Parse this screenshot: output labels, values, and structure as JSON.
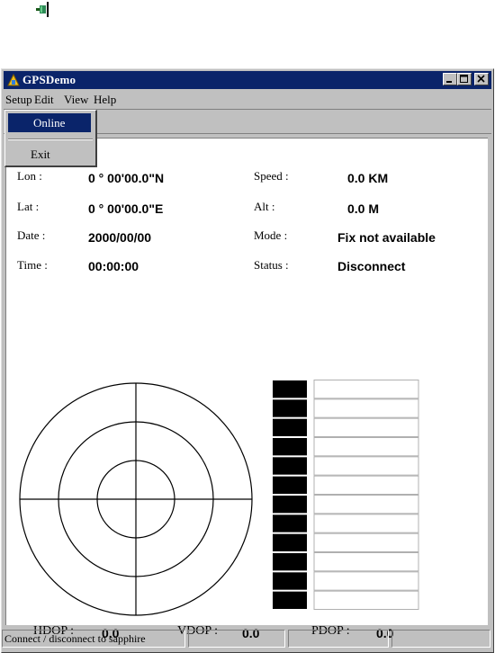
{
  "window": {
    "title": "GPSDemo"
  },
  "menu": {
    "setup": "Setup",
    "edit": "Edit",
    "view": "View",
    "help": "Help"
  },
  "setup_menu": {
    "online": "Online",
    "exit": "Exit"
  },
  "fields": {
    "lon_label": "Lon :",
    "lon_value": "0 ° 00'00.0\"N",
    "lat_label": "Lat :",
    "lat_value": "0 ° 00'00.0\"E",
    "date_label": "Date :",
    "date_value": "2000/00/00",
    "time_label": "Time :",
    "time_value": "00:00:00",
    "speed_label": "Speed :",
    "speed_value": "0.0 KM",
    "alt_label": "Alt :",
    "alt_value": "0.0 M",
    "mode_label": "Mode :",
    "mode_value": "Fix not available",
    "status_label": "Status :",
    "status_value": "Disconnect"
  },
  "dop": {
    "hdop_label": "HDOP :",
    "hdop_value": "0.0",
    "vdop_label": "VDOP :",
    "vdop_value": "0.0",
    "pdop_label": "PDOP :",
    "pdop_value": "0.0"
  },
  "satellite_bars": {
    "count": 12
  },
  "statusbar": {
    "message": "Connect / disconnect to sapphire"
  },
  "colors": {
    "titlebar": "#0a246a",
    "window_face": "#c0c0c0",
    "highlight": "#0a246a",
    "bar_fill": "#000000"
  },
  "icons": [
    "connector-icon",
    "app-icon",
    "minimize-icon",
    "maximize-icon",
    "close-icon"
  ]
}
